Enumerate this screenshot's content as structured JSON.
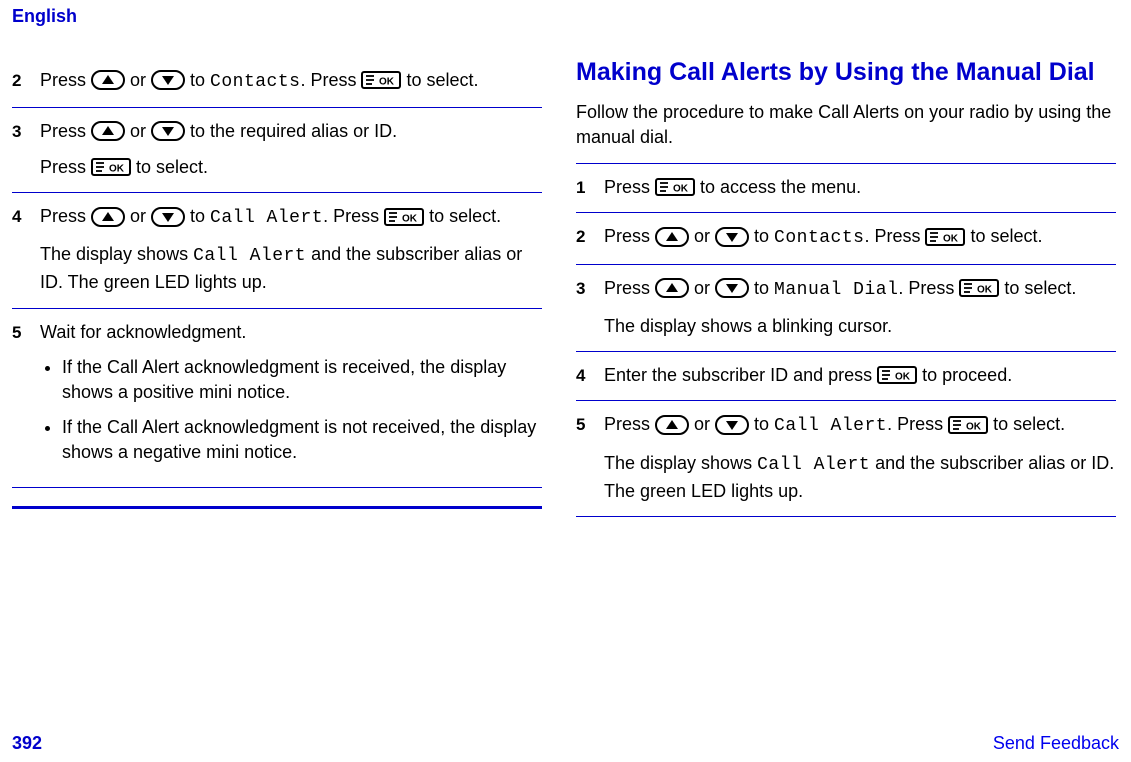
{
  "header": {
    "language": "English"
  },
  "left": {
    "steps": [
      {
        "num": "2",
        "lines": [
          {
            "parts": [
              {
                "t": "text",
                "v": "Press "
              },
              {
                "t": "icon",
                "v": "up"
              },
              {
                "t": "text",
                "v": " or "
              },
              {
                "t": "icon",
                "v": "down"
              },
              {
                "t": "text",
                "v": " to "
              },
              {
                "t": "mono",
                "v": "Contacts"
              },
              {
                "t": "text",
                "v": ". Press "
              },
              {
                "t": "icon",
                "v": "ok"
              },
              {
                "t": "text",
                "v": " to select."
              }
            ]
          }
        ]
      },
      {
        "num": "3",
        "lines": [
          {
            "parts": [
              {
                "t": "text",
                "v": "Press "
              },
              {
                "t": "icon",
                "v": "up"
              },
              {
                "t": "text",
                "v": " or "
              },
              {
                "t": "icon",
                "v": "down"
              },
              {
                "t": "text",
                "v": " to the required alias or ID."
              }
            ]
          },
          {
            "gap": true,
            "parts": [
              {
                "t": "text",
                "v": "Press "
              },
              {
                "t": "icon",
                "v": "ok"
              },
              {
                "t": "text",
                "v": " to select."
              }
            ]
          }
        ]
      },
      {
        "num": "4",
        "lines": [
          {
            "parts": [
              {
                "t": "text",
                "v": "Press "
              },
              {
                "t": "icon",
                "v": "up"
              },
              {
                "t": "text",
                "v": " or "
              },
              {
                "t": "icon",
                "v": "down"
              },
              {
                "t": "text",
                "v": " to "
              },
              {
                "t": "mono",
                "v": "Call Alert"
              },
              {
                "t": "text",
                "v": ". Press "
              },
              {
                "t": "icon",
                "v": "ok"
              },
              {
                "t": "text",
                "v": " to select."
              }
            ]
          },
          {
            "gap": true,
            "parts": [
              {
                "t": "text",
                "v": "The display shows "
              },
              {
                "t": "mono",
                "v": "Call Alert"
              },
              {
                "t": "text",
                "v": " and the subscriber alias or ID. The green LED lights up."
              }
            ]
          }
        ]
      },
      {
        "num": "5",
        "plain": "Wait for acknowledgment.",
        "bullets": [
          "If the Call Alert acknowledgment is received, the display shows a positive mini notice.",
          "If the Call Alert acknowledgment is not received, the display shows a negative mini notice."
        ]
      }
    ]
  },
  "right": {
    "title": "Making Call Alerts by Using the Manual Dial",
    "intro": "Follow the procedure to make Call Alerts on your radio by using the manual dial.",
    "steps": [
      {
        "num": "1",
        "lines": [
          {
            "parts": [
              {
                "t": "text",
                "v": "Press "
              },
              {
                "t": "icon",
                "v": "ok"
              },
              {
                "t": "text",
                "v": " to access the menu."
              }
            ]
          }
        ]
      },
      {
        "num": "2",
        "lines": [
          {
            "parts": [
              {
                "t": "text",
                "v": "Press "
              },
              {
                "t": "icon",
                "v": "up"
              },
              {
                "t": "text",
                "v": " or "
              },
              {
                "t": "icon",
                "v": "down"
              },
              {
                "t": "text",
                "v": " to "
              },
              {
                "t": "mono",
                "v": "Contacts"
              },
              {
                "t": "text",
                "v": ". Press "
              },
              {
                "t": "icon",
                "v": "ok"
              },
              {
                "t": "text",
                "v": " to select."
              }
            ]
          }
        ]
      },
      {
        "num": "3",
        "lines": [
          {
            "parts": [
              {
                "t": "text",
                "v": "Press "
              },
              {
                "t": "icon",
                "v": "up"
              },
              {
                "t": "text",
                "v": " or "
              },
              {
                "t": "icon",
                "v": "down"
              },
              {
                "t": "text",
                "v": " to "
              },
              {
                "t": "mono",
                "v": "Manual Dial"
              },
              {
                "t": "text",
                "v": ". Press "
              },
              {
                "t": "icon",
                "v": "ok"
              },
              {
                "t": "text",
                "v": " to select."
              }
            ]
          },
          {
            "gap": true,
            "parts": [
              {
                "t": "text",
                "v": "The display shows a blinking cursor."
              }
            ]
          }
        ]
      },
      {
        "num": "4",
        "lines": [
          {
            "parts": [
              {
                "t": "text",
                "v": "Enter the subscriber ID and press "
              },
              {
                "t": "icon",
                "v": "ok"
              },
              {
                "t": "text",
                "v": " to proceed."
              }
            ]
          }
        ]
      },
      {
        "num": "5",
        "lines": [
          {
            "parts": [
              {
                "t": "text",
                "v": "Press "
              },
              {
                "t": "icon",
                "v": "up"
              },
              {
                "t": "text",
                "v": " or "
              },
              {
                "t": "icon",
                "v": "down"
              },
              {
                "t": "text",
                "v": " to "
              },
              {
                "t": "mono",
                "v": "Call Alert"
              },
              {
                "t": "text",
                "v": ". Press "
              },
              {
                "t": "icon",
                "v": "ok"
              },
              {
                "t": "text",
                "v": " to select."
              }
            ]
          },
          {
            "gap": true,
            "parts": [
              {
                "t": "text",
                "v": "The display shows "
              },
              {
                "t": "mono",
                "v": "Call Alert"
              },
              {
                "t": "text",
                "v": " and the subscriber alias or ID. The green LED lights up."
              }
            ]
          }
        ]
      }
    ]
  },
  "footer": {
    "page": "392",
    "feedback": "Send Feedback"
  },
  "icons": {
    "up": "up-arrow-button-icon",
    "down": "down-arrow-button-icon",
    "ok": "menu-ok-button-icon"
  }
}
